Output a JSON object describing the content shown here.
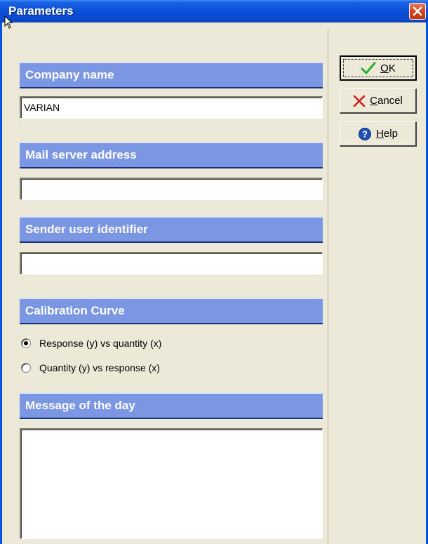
{
  "window": {
    "title": "Parameters",
    "colors": {
      "titlebar": "#0a4fd8",
      "section_header": "#7b96e2",
      "face": "#ece9d8"
    }
  },
  "sections": {
    "company_name": {
      "label": "Company name",
      "value": "VARIAN"
    },
    "mail_server": {
      "label": "Mail server address",
      "value": ""
    },
    "sender_user": {
      "label": "Sender user identifier",
      "value": ""
    },
    "calibration": {
      "label": "Calibration Curve",
      "options": [
        {
          "label": "Response (y) vs quantity (x)",
          "checked": true
        },
        {
          "label": "Quantity (y) vs response (x)",
          "checked": false
        }
      ]
    },
    "message": {
      "label": "Message of the day",
      "value": ""
    }
  },
  "buttons": {
    "ok": {
      "mnemonic": "O",
      "rest": "K",
      "icon": "checkmark-icon"
    },
    "cancel": {
      "mnemonic": "C",
      "rest": "ancel",
      "icon": "cross-icon"
    },
    "help": {
      "mnemonic": "H",
      "rest": "elp",
      "icon": "help-icon"
    }
  }
}
